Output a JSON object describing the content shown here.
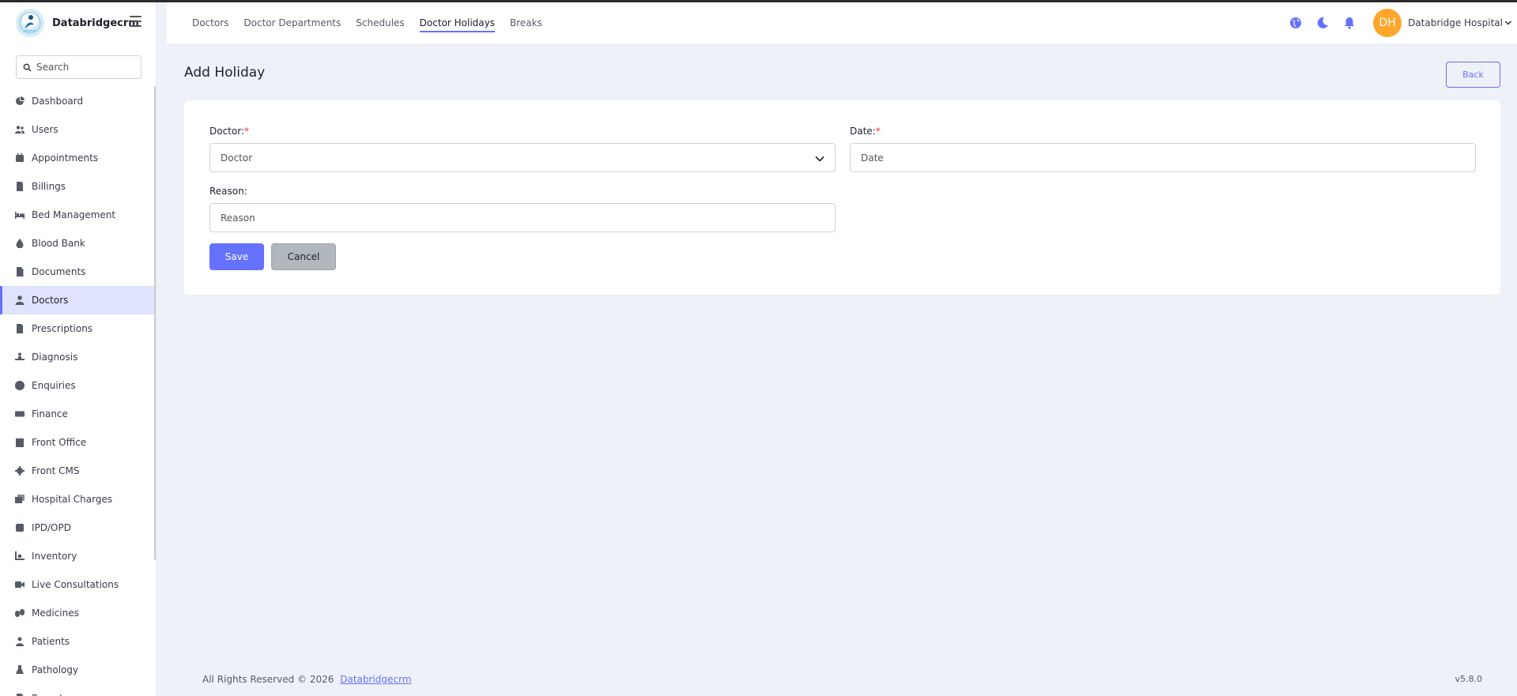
{
  "brand": {
    "name": "Databridgecrm"
  },
  "sidebar": {
    "search_placeholder": "Search",
    "items": [
      {
        "label": "Dashboard",
        "icon": "dashboard-icon"
      },
      {
        "label": "Users",
        "icon": "users-icon"
      },
      {
        "label": "Appointments",
        "icon": "appointments-icon"
      },
      {
        "label": "Billings",
        "icon": "billings-icon"
      },
      {
        "label": "Bed Management",
        "icon": "bed-icon"
      },
      {
        "label": "Blood Bank",
        "icon": "blood-drop-icon"
      },
      {
        "label": "Documents",
        "icon": "document-icon"
      },
      {
        "label": "Doctors",
        "icon": "doctor-icon",
        "active": true
      },
      {
        "label": "Prescriptions",
        "icon": "prescription-icon"
      },
      {
        "label": "Diagnosis",
        "icon": "diagnosis-icon"
      },
      {
        "label": "Enquiries",
        "icon": "question-icon"
      },
      {
        "label": "Finance",
        "icon": "money-icon"
      },
      {
        "label": "Front Office",
        "icon": "front-office-icon"
      },
      {
        "label": "Front CMS",
        "icon": "gear-icon"
      },
      {
        "label": "Hospital Charges",
        "icon": "charges-icon"
      },
      {
        "label": "IPD/OPD",
        "icon": "ipd-opd-icon"
      },
      {
        "label": "Inventory",
        "icon": "inventory-icon"
      },
      {
        "label": "Live Consultations",
        "icon": "video-icon"
      },
      {
        "label": "Medicines",
        "icon": "medicine-icon"
      },
      {
        "label": "Patients",
        "icon": "patient-icon"
      },
      {
        "label": "Pathology",
        "icon": "flask-icon"
      },
      {
        "label": "Reports",
        "icon": "report-icon"
      }
    ]
  },
  "header": {
    "tabs": [
      {
        "label": "Doctors"
      },
      {
        "label": "Doctor Departments"
      },
      {
        "label": "Schedules"
      },
      {
        "label": "Doctor Holidays",
        "active": true
      },
      {
        "label": "Breaks"
      }
    ],
    "avatar_initials": "DH",
    "user_name": "Databridge Hospital",
    "accent_color": "#6571ff",
    "avatar_color": "#ffa62b"
  },
  "page": {
    "title": "Add Holiday",
    "back_label": "Back"
  },
  "form": {
    "doctor_label": "Doctor:",
    "doctor_value": "Doctor",
    "date_label": "Date:",
    "date_placeholder": "Date",
    "reason_label": "Reason:",
    "reason_placeholder": "Reason",
    "required_mark": "*",
    "save_label": "Save",
    "cancel_label": "Cancel"
  },
  "footer": {
    "copyright": "All Rights Reserved © 2026",
    "link": "Databridgecrm",
    "version": "v5.8.0"
  }
}
